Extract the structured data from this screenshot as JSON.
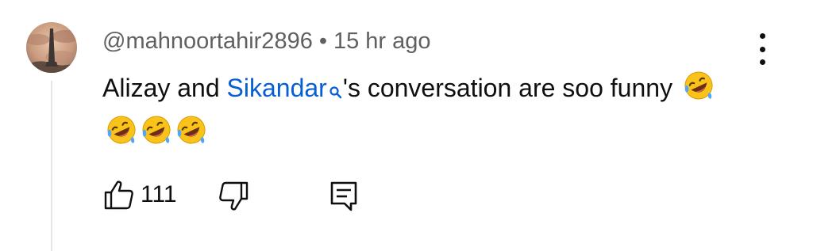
{
  "comment": {
    "author": "@mahnoortahir2896",
    "separator": "•",
    "timestamp": "15 hr ago",
    "text_part1": "Alizay and ",
    "mention": "Sikandar",
    "text_part2": "'s conversation are soo funny",
    "emoji_count": 4,
    "emoji_icon": "rolling-on-floor-laughing",
    "like_count": "111",
    "colors": {
      "mention": "#065fd4",
      "meta": "#606060",
      "text": "#0f0f0f"
    }
  },
  "icons": {
    "more": "more-vertical-icon",
    "like": "thumbs-up-icon",
    "dislike": "thumbs-down-icon",
    "reply": "reply-comment-icon",
    "search": "search-icon"
  }
}
